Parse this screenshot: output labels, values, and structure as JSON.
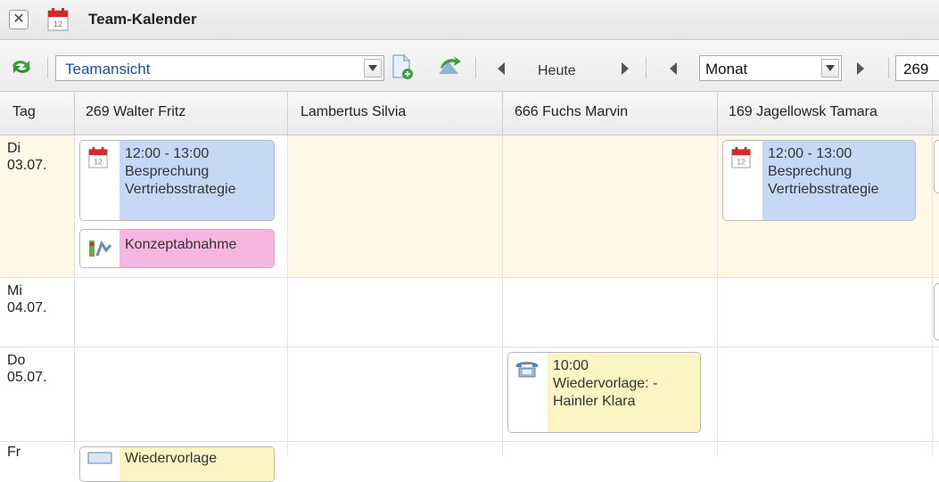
{
  "window": {
    "title": "Team-Kalender"
  },
  "toolbar": {
    "view_select": "Teamansicht",
    "heute_label": "Heute",
    "period_select": "Monat",
    "right_field": "269"
  },
  "grid": {
    "columns": [
      "Tag",
      "269 Walter Fritz",
      "Lambertus Silvia",
      "666 Fuchs Marvin",
      "169 Jagellowsk Tamara"
    ],
    "days": [
      {
        "weekday": "Di",
        "date": "03.07."
      },
      {
        "weekday": "Mi",
        "date": "04.07."
      },
      {
        "weekday": "Do",
        "date": "05.07."
      },
      {
        "weekday": "Fr",
        "date": ""
      }
    ],
    "events": [
      {
        "icon": "calendar-icon",
        "color": "#c5d9f6",
        "lines": [
          "12:00 - 13:00",
          "Besprechung",
          "Vertriebsstrategie"
        ]
      },
      {
        "icon": "task-icon",
        "color": "#f7b6e0",
        "lines": [
          "Konzeptabnahme"
        ]
      },
      {
        "icon": "calendar-icon",
        "color": "#c5d9f6",
        "lines": [
          "12:00 - 13:00",
          "Besprechung",
          "Vertriebsstrategie"
        ]
      },
      {
        "icon": "phone-icon",
        "color": "#fcf4c2",
        "lines": [
          "10:00",
          "Wiedervorlage: -",
          "Hainler Klara"
        ]
      },
      {
        "icon": "note-icon",
        "color": "#fcf4c2",
        "lines": [
          "Wiedervorlage"
        ]
      }
    ]
  },
  "colors": {
    "today_row": "#fdf9e6",
    "accent_text": "#1a4fa3"
  }
}
